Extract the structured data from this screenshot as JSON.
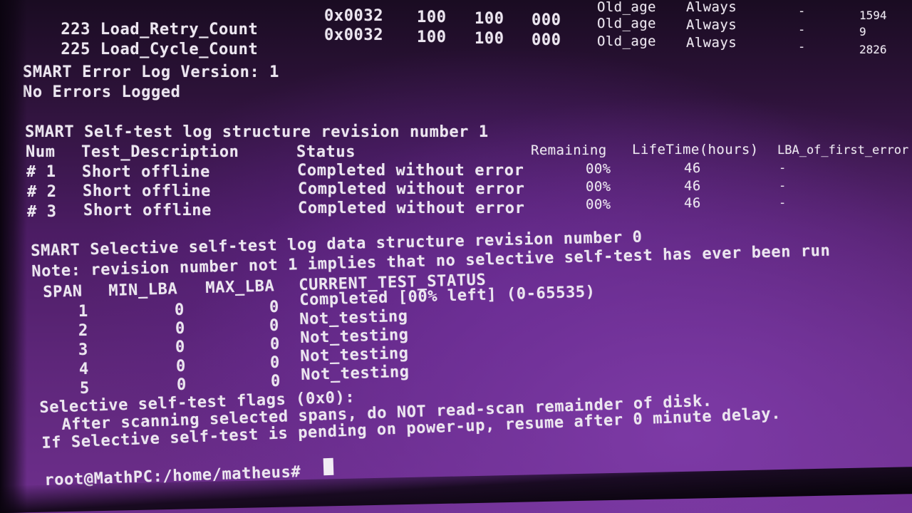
{
  "terminal": {
    "top_partial": [
      {
        "id": "223",
        "name": "Load_Retry_Count",
        "flag": "0x0032",
        "value": "100",
        "worst": "100",
        "thresh": "000",
        "type": "Old_age",
        "updated": "Always",
        "when_failed": "-",
        "raw": "9"
      },
      {
        "id": "225",
        "name": "Load_Cycle_Count",
        "flag": "0x0032",
        "value": "100",
        "worst": "100",
        "thresh": "000",
        "type": "Old_age",
        "updated": "Always",
        "when_failed": "-",
        "raw": "2826"
      }
    ],
    "top_partial_prev_raw": "1594",
    "error_log_version": "SMART Error Log Version: 1",
    "no_errors": "No Errors Logged",
    "selftest_header": "SMART Self-test log structure revision number 1",
    "selftest_columns": [
      "Num",
      "Test_Description",
      "Status",
      "Remaining",
      "LifeTime(hours)",
      "LBA_of_first_error"
    ],
    "selftest_rows": [
      {
        "num": "# 1",
        "desc": "Short offline",
        "status": "Completed without error",
        "remaining": "00%",
        "lifetime": "46",
        "lba": "-"
      },
      {
        "num": "# 2",
        "desc": "Short offline",
        "status": "Completed without error",
        "remaining": "00%",
        "lifetime": "46",
        "lba": "-"
      },
      {
        "num": "# 3",
        "desc": "Short offline",
        "status": "Completed without error",
        "remaining": "00%",
        "lifetime": "46",
        "lba": "-"
      }
    ],
    "selective_header": "SMART Selective self-test log data structure revision number 0",
    "selective_note": "Note: revision number not 1 implies that no selective self-test has ever been run",
    "selective_columns": [
      "SPAN",
      "MIN_LBA",
      "MAX_LBA",
      "CURRENT_TEST_STATUS"
    ],
    "selective_rows": [
      {
        "span": "1",
        "min": "0",
        "max": "0",
        "status": "Completed [00% left] (0-65535)"
      },
      {
        "span": "2",
        "min": "0",
        "max": "0",
        "status": "Not_testing"
      },
      {
        "span": "3",
        "min": "0",
        "max": "0",
        "status": "Not_testing"
      },
      {
        "span": "4",
        "min": "0",
        "max": "0",
        "status": "Not_testing"
      },
      {
        "span": "5",
        "min": "0",
        "max": "0",
        "status": "Not_testing"
      }
    ],
    "flags_header": "Selective self-test flags (0x0):",
    "flags_line1": "After scanning selected spans, do NOT read-scan remainder of disk.",
    "flags_line2": "If Selective self-test is pending on power-up, resume after 0 minute delay.",
    "prompt": "root@MathPC:/home/matheus#"
  },
  "colors": {
    "text": "#ece6f0",
    "background_top": "#1a0c22",
    "background_bottom": "#6e2f8d"
  }
}
